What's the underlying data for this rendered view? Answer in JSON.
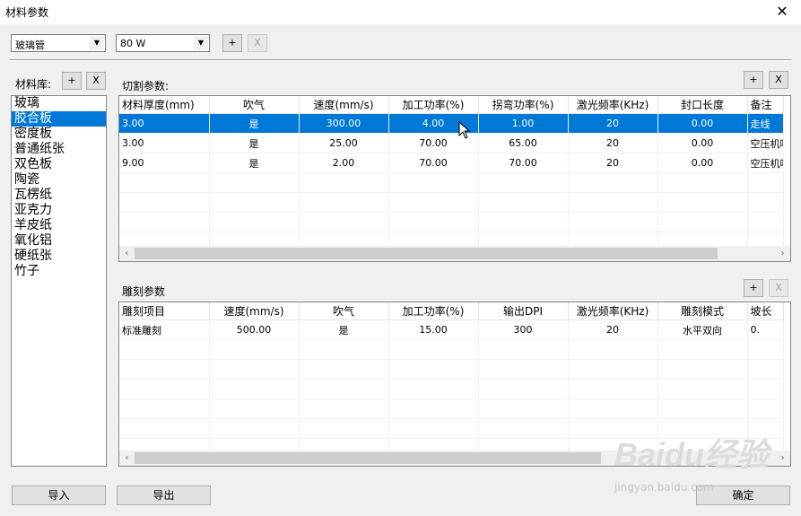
{
  "window": {
    "title": "材料参数",
    "close_glyph": "✕"
  },
  "toolbar": {
    "material_combo": "玻璃管",
    "power_combo": "80 W",
    "add_label": "+",
    "remove_label": "X"
  },
  "library": {
    "label": "材料库:",
    "add_label": "+",
    "remove_label": "X",
    "items": [
      "玻璃",
      "胶合板",
      "密度板",
      "普通纸张",
      "双色板",
      "陶瓷",
      "瓦楞纸",
      "亚克力",
      "羊皮纸",
      "氧化铝",
      "硬纸张",
      "竹子"
    ],
    "selected_index": 1
  },
  "cutting": {
    "label": "切割参数:",
    "add_label": "+",
    "remove_label": "X",
    "columns": [
      "材料厚度(mm)",
      "吹气",
      "速度(mm/s)",
      "加工功率(%)",
      "拐弯功率(%)",
      "激光频率(KHz)",
      "封口长度",
      "备注"
    ],
    "rows": [
      [
        "3.00",
        "是",
        "300.00",
        "4.00",
        "1.00",
        "20",
        "0.00",
        "走线"
      ],
      [
        "3.00",
        "是",
        "25.00",
        "70.00",
        "65.00",
        "20",
        "0.00",
        "空压机吹"
      ],
      [
        "9.00",
        "是",
        "2.00",
        "70.00",
        "70.00",
        "20",
        "0.00",
        "空压机吹"
      ]
    ],
    "selected_row": 0
  },
  "engraving": {
    "label": "雕刻参数",
    "add_label": "+",
    "remove_label": "X",
    "columns": [
      "雕刻项目",
      "速度(mm/s)",
      "吹气",
      "加工功率(%)",
      "输出DPI",
      "激光频率(KHz)",
      "雕刻模式",
      "坡长"
    ],
    "rows": [
      [
        "标准雕刻",
        "500.00",
        "是",
        "15.00",
        "300",
        "20",
        "水平双向",
        "0."
      ]
    ]
  },
  "footer": {
    "import_label": "导入",
    "export_label": "导出",
    "ok_label": "确定"
  },
  "watermark": {
    "brand": "Baidu经验",
    "url": "jingyan.baidu.com"
  }
}
